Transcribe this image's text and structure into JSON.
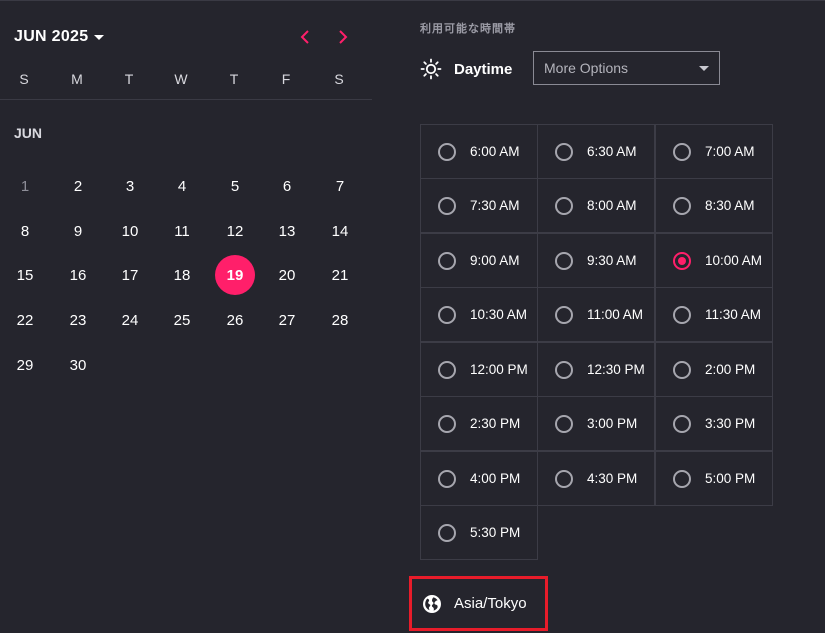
{
  "calendar": {
    "month_year": "JUN 2025",
    "month_label": "JUN",
    "weekdays": [
      "S",
      "M",
      "T",
      "W",
      "T",
      "F",
      "S"
    ],
    "days": [
      "1",
      "2",
      "3",
      "4",
      "5",
      "6",
      "7",
      "8",
      "9",
      "10",
      "11",
      "12",
      "13",
      "14",
      "15",
      "16",
      "17",
      "18",
      "19",
      "20",
      "21",
      "22",
      "23",
      "24",
      "25",
      "26",
      "27",
      "28",
      "29",
      "30"
    ],
    "selected_day": "19",
    "muted_day": "1"
  },
  "availability": {
    "title": "利用可能な時間帯",
    "period_label": "Daytime",
    "dropdown_value": "More Options",
    "slots": [
      "6:00 AM",
      "6:30 AM",
      "7:00 AM",
      "7:30 AM",
      "8:00 AM",
      "8:30 AM",
      "9:00 AM",
      "9:30 AM",
      "10:00 AM",
      "10:30 AM",
      "11:00 AM",
      "11:30 AM",
      "12:00 PM",
      "12:30 PM",
      "2:00 PM",
      "2:30 PM",
      "3:00 PM",
      "3:30 PM",
      "4:00 PM",
      "4:30 PM",
      "5:00 PM",
      "5:30 PM"
    ],
    "selected_slot": "10:00 AM"
  },
  "timezone": {
    "label": "Asia/Tokyo"
  },
  "colors": {
    "accent": "#ff1f6a",
    "background": "#25252d",
    "highlight_border": "#e81c2a"
  },
  "icons": {
    "prev": "chevron-left-icon",
    "next": "chevron-right-icon",
    "daytime": "sun-icon",
    "timezone": "globe-icon"
  }
}
